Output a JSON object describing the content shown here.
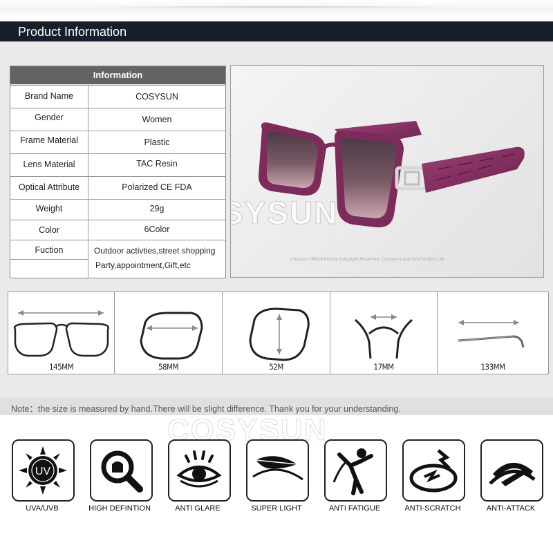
{
  "header": {
    "title": "Product Information"
  },
  "info_table": {
    "heading": "Information",
    "rows": [
      {
        "key": "Brand Name",
        "value": "COSYSUN"
      },
      {
        "key": "Gender",
        "value": "Women"
      },
      {
        "key": "Frame Material",
        "value": "Plastic"
      },
      {
        "key": "Lens Material",
        "value": "TAC Resin"
      },
      {
        "key": "Optical Attribute",
        "value": "Polarized CE FDA"
      },
      {
        "key": "Weight",
        "value": "29g"
      },
      {
        "key": "Color",
        "value": "6Color"
      },
      {
        "key": "Fuction",
        "value_line1": "Outdoor activties,street shopping",
        "value_line2": "Party,appointment,Gift,etc"
      }
    ]
  },
  "photo": {
    "watermark": "COSYSUN",
    "copyright": "Cosysun Official Picture Copyright Reserved. Cosysun Lead You Fashion Life",
    "frame_color": "#7d2b5a"
  },
  "sizes": [
    {
      "label": "145MM",
      "icon": "frame-width-icon"
    },
    {
      "label": "58MM",
      "icon": "lens-width-icon"
    },
    {
      "label": "52M",
      "icon": "lens-height-icon"
    },
    {
      "label": "17MM",
      "icon": "bridge-width-icon"
    },
    {
      "label": "133MM",
      "icon": "temple-length-icon"
    }
  ],
  "note": "Note：the size is measured by hand.There will be slight difference.   Thank you for your understanding.",
  "watermark2": "COSYSUN",
  "features": [
    {
      "label": "UVA/UVB",
      "icon": "uv-sun-icon",
      "badge": "UV"
    },
    {
      "label": "HIGH DEFINTION",
      "icon": "magnifier-icon"
    },
    {
      "label": "ANTI GLARE",
      "icon": "eye-icon"
    },
    {
      "label": "SUPER LIGHT",
      "icon": "feather-icon"
    },
    {
      "label": "ANTI FATIGUE",
      "icon": "fatigue-icon"
    },
    {
      "label": "ANTI-SCRATCH",
      "icon": "scratch-icon"
    },
    {
      "label": "ANTI-ATTACK",
      "icon": "shield-attack-icon"
    }
  ]
}
